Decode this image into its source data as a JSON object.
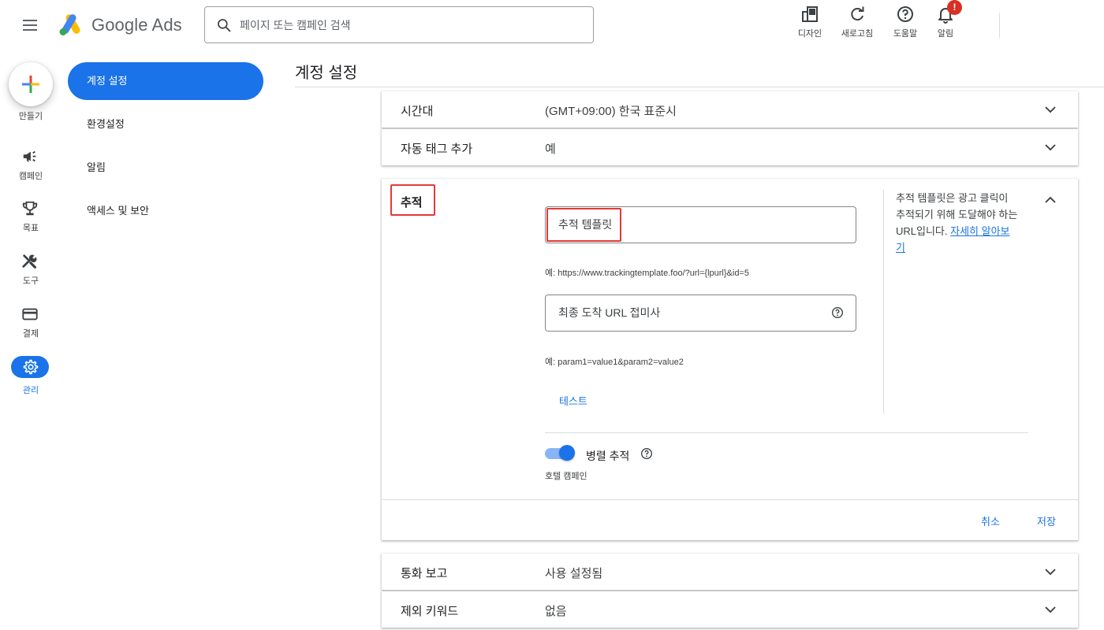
{
  "app": {
    "name": "Google Ads"
  },
  "search": {
    "placeholder": "페이지 또는 캠페인 검색",
    "value": ""
  },
  "header_tools": [
    {
      "icon": "appearance-icon",
      "label": "디자인"
    },
    {
      "icon": "refresh-icon",
      "label": "새로고침"
    },
    {
      "icon": "help-icon",
      "label": "도움말"
    },
    {
      "icon": "bell-icon",
      "label": "알림",
      "badge": "!"
    }
  ],
  "rail": {
    "create_label": "만들기",
    "items": [
      {
        "icon": "megaphone-icon",
        "label": "캠페인"
      },
      {
        "icon": "trophy-icon",
        "label": "목표"
      },
      {
        "icon": "tools-icon",
        "label": "도구"
      },
      {
        "icon": "credit-card-icon",
        "label": "결제"
      },
      {
        "icon": "gear-icon",
        "label": "관리",
        "active": true
      }
    ]
  },
  "subnav": [
    {
      "label": "계정 설정",
      "active": true
    },
    {
      "label": "환경설정"
    },
    {
      "label": "알림"
    },
    {
      "label": "액세스 및 보안"
    }
  ],
  "page": {
    "title": "계정 설정"
  },
  "settings_rows_top": [
    {
      "label": "시간대",
      "value": "(GMT+09:00) 한국 표준시"
    },
    {
      "label": "자동 태그 추가",
      "value": "예"
    }
  ],
  "tracking": {
    "title": "추적",
    "template_placeholder": "추적 템플릿",
    "template_value": "",
    "template_hint": "예: https://www.trackingtemplate.foo/?url={lpurl}&id=5",
    "suffix_placeholder": "최종 도착 URL 접미사",
    "suffix_value": "",
    "suffix_hint": "예: param1=value1&param2=value2",
    "test_label": "테스트",
    "side_text": "추적 템플릿은 광고 클릭이 추적되기 위해 도달해야 하는 URL입니다. ",
    "learn_more": "자세히 알아보기",
    "parallel_label": "병렬 추적",
    "parallel_enabled": true,
    "parallel_sub": "호텔 캠페인",
    "cancel_label": "취소",
    "save_label": "저장"
  },
  "settings_rows_bottom": [
    {
      "label": "통화 보고",
      "value": "사용 설정됨"
    },
    {
      "label": "제외 키워드",
      "value": "없음"
    }
  ],
  "colors": {
    "accent": "#1a73e8",
    "highlight": "#e53935",
    "badge": "#d93025"
  }
}
